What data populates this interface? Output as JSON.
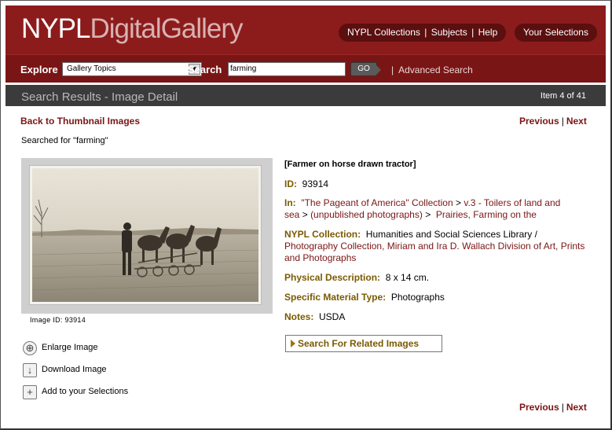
{
  "header": {
    "logo_part1": "NYPL",
    "logo_part2": "DigitalGallery",
    "nav": [
      "NYPL Collections",
      "Subjects",
      "Help"
    ],
    "your_selections": "Your Selections"
  },
  "search_bar": {
    "explore_label": "Explore",
    "explore_value": "Gallery Topics",
    "search_label": "Search",
    "search_value": "farming",
    "go_label": "GO",
    "advanced_search": "Advanced Search"
  },
  "title_bar": {
    "title": "Search Results - Image Detail",
    "item_count": "Item 4 of 41"
  },
  "nav_links": {
    "back": "Back to Thumbnail Images",
    "previous": "Previous",
    "next": "Next",
    "sep": "|"
  },
  "searched_for": "Searched for \"farming\"",
  "image": {
    "id_caption": "Image ID: 93914"
  },
  "actions": [
    {
      "label": "Enlarge Image",
      "icon": "zoom-plus-icon"
    },
    {
      "label": "Download Image",
      "icon": "download-arrow-icon"
    },
    {
      "label": "Add to your Selections",
      "icon": "plus-icon"
    }
  ],
  "record": {
    "title": "[Farmer on horse drawn tractor]",
    "id_label": "ID:",
    "id_value": "93914",
    "in_label": "In:",
    "in_link1": "\"The Pageant of America\" Collection",
    "in_link2": "v.3 - Toilers of land and sea",
    "in_link3": "(unpublished photographs)",
    "in_link4": "Prairies, Farming on the",
    "collection_label": "NYPL Collection:",
    "collection_value1": "Humanities and Social Sciences Library",
    "collection_link": "Photography Collection, Miriam and Ira D. Wallach Division of Art, Prints and Photographs",
    "physical_label": "Physical Description:",
    "physical_value": "8 x 14 cm.",
    "material_label": "Specific Material Type:",
    "material_value": "Photographs",
    "notes_label": "Notes:",
    "notes_value": "USDA",
    "related_button": "Search For Related Images"
  },
  "colors": {
    "header_red": "#8c1c1c",
    "bar_red": "#7a1515",
    "label_gold": "#7a5a00",
    "grey_bar": "#3b3b3b"
  }
}
